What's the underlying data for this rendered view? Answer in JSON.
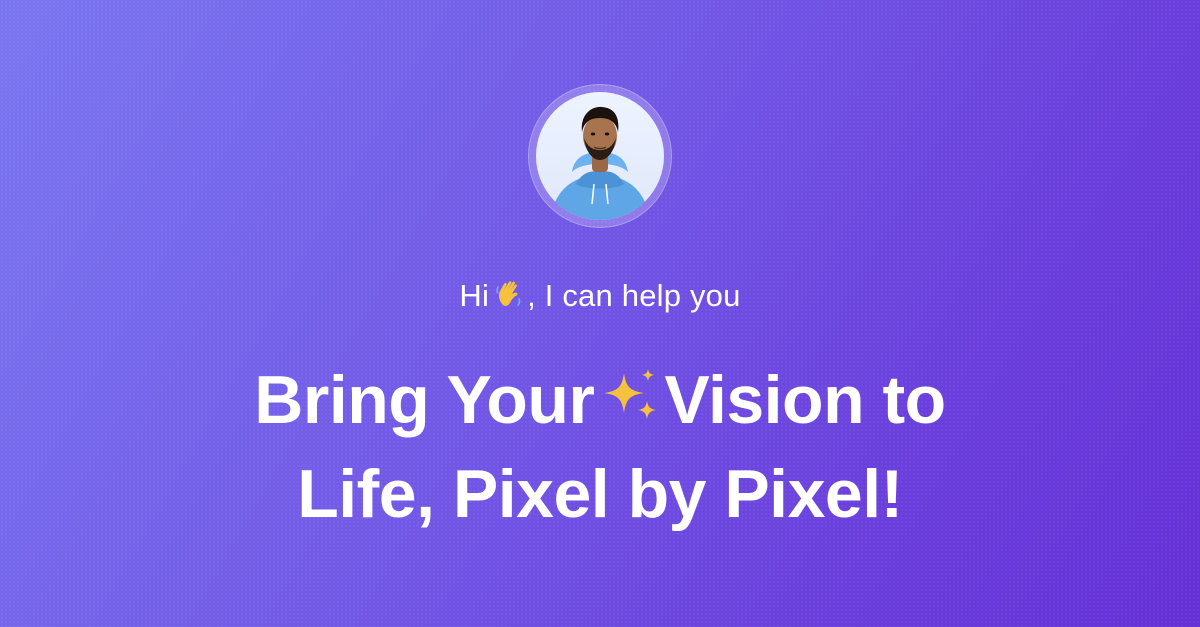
{
  "greeting": {
    "before": "Hi",
    "emoji": "waving-hand-icon",
    "after": ", I can help you"
  },
  "headline": {
    "line1_before": "Bring Your",
    "emoji": "sparkles-icon",
    "line1_after": "Vision to",
    "line2": "Life, Pixel by Pixel!"
  },
  "colors": {
    "gradient_start": "#7a76f0",
    "gradient_end": "#6530d6",
    "text": "#ffffff",
    "hoodie": "#5fa6e6",
    "emoji_yellow": "#f6c23e"
  }
}
